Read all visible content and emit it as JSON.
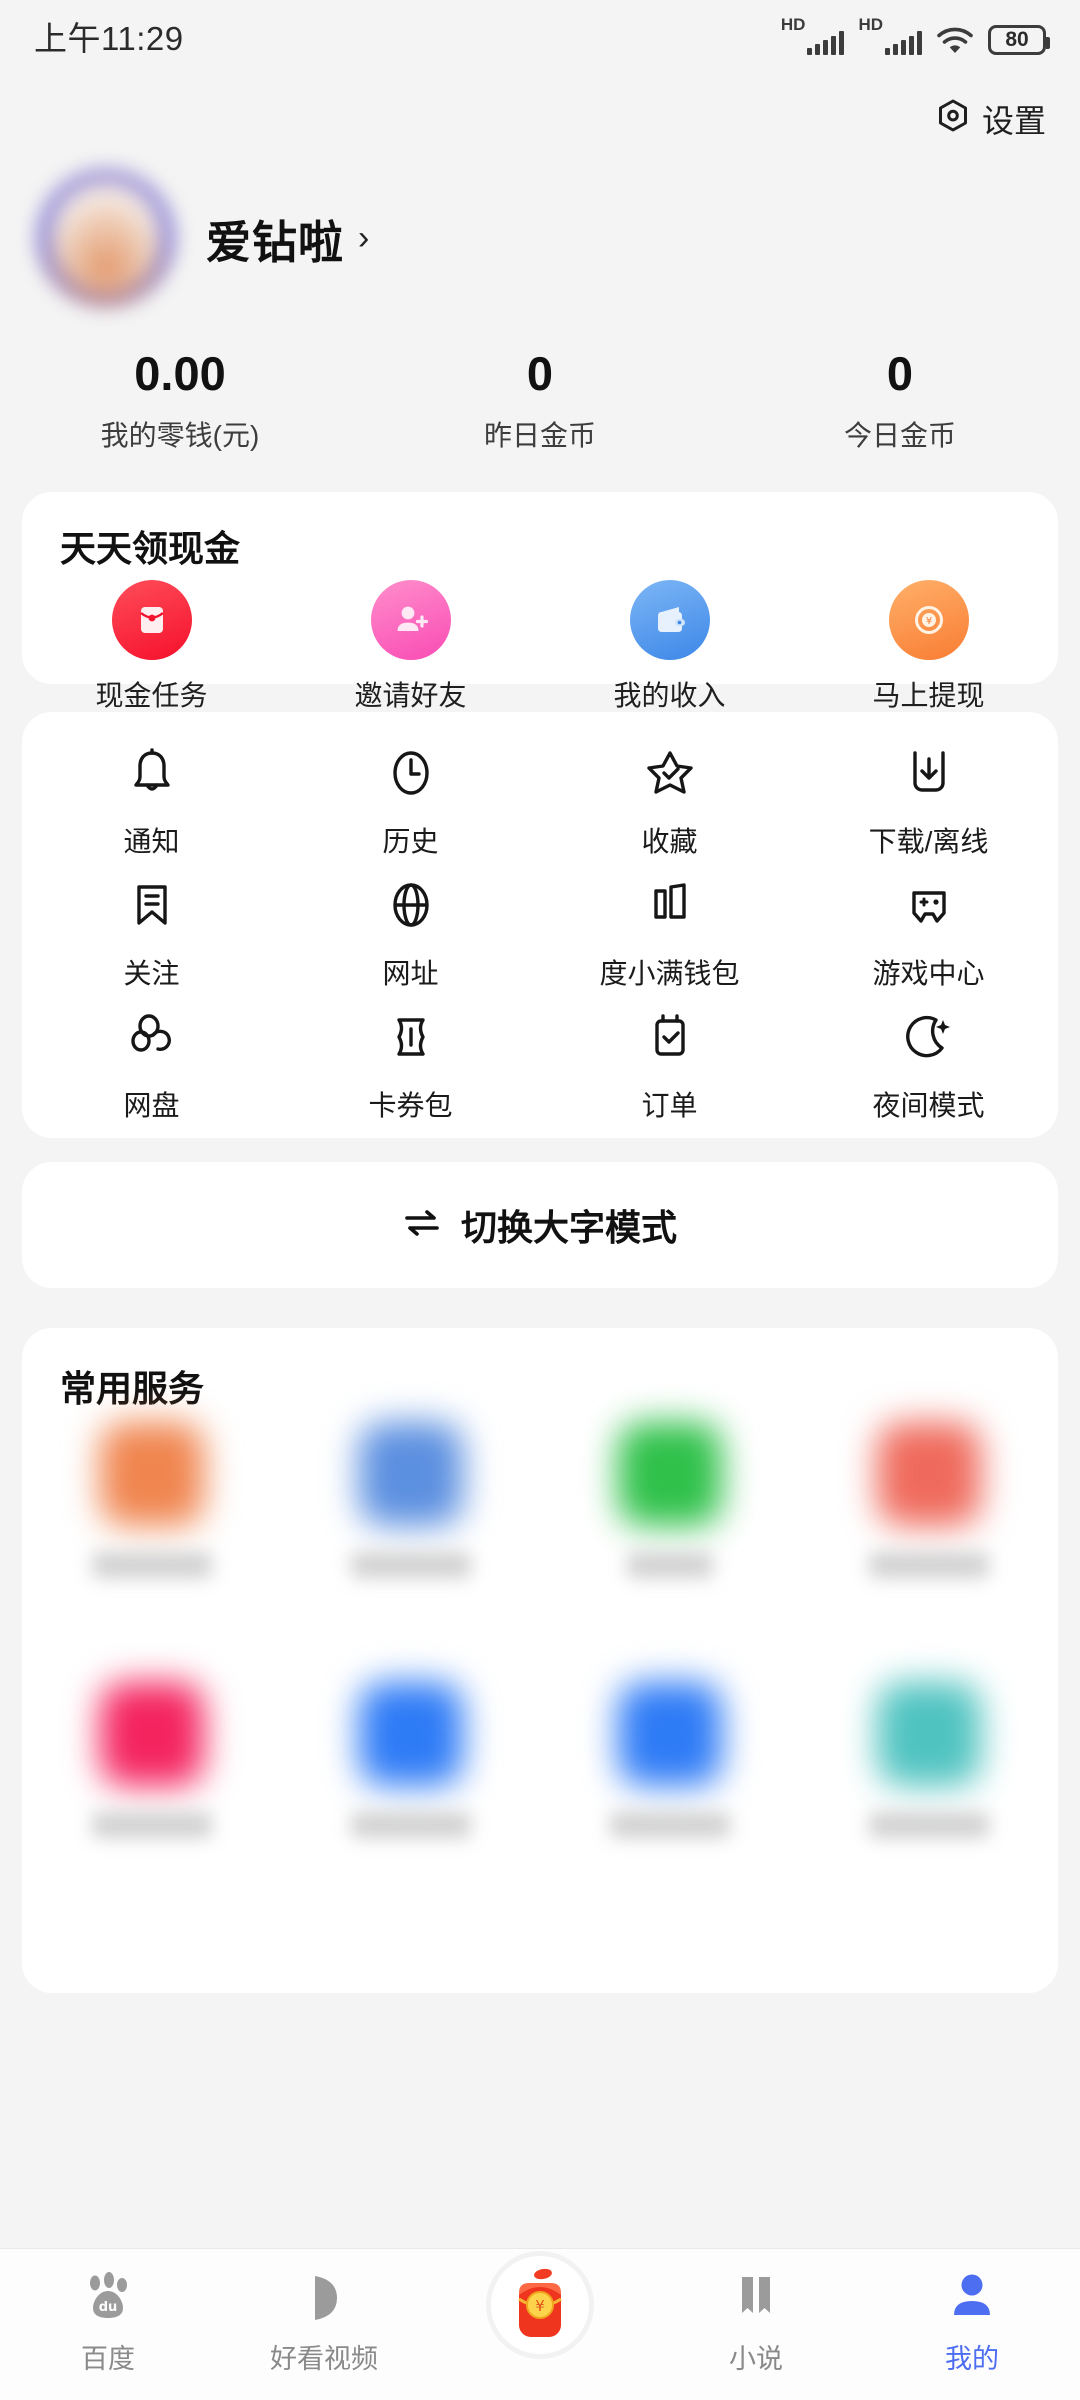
{
  "statusbar": {
    "time": "上午11:29",
    "signal1_label": "HD",
    "signal2_label": "HD",
    "battery_level": "80",
    "wifi_icon": "wifi-icon"
  },
  "header": {
    "settings_label": "设置",
    "settings_icon": "gear-icon"
  },
  "profile": {
    "username": "爱钻啦",
    "chevron": "›",
    "avatar_icon": "avatar"
  },
  "stats": [
    {
      "value": "0.00",
      "caption": "我的零钱(元)"
    },
    {
      "value": "0",
      "caption": "昨日金币"
    },
    {
      "value": "0",
      "caption": "今日金币"
    }
  ],
  "cash_section": {
    "title": "天天领现金",
    "items": [
      {
        "label": "现金任务",
        "icon": "red-envelope-icon",
        "color": "#f5102b"
      },
      {
        "label": "邀请好友",
        "icon": "add-friend-icon",
        "color": "#f94bb4"
      },
      {
        "label": "我的收入",
        "icon": "wallet-icon",
        "color": "#3c87e8"
      },
      {
        "label": "马上提现",
        "icon": "withdraw-coin-icon",
        "color": "#f97c32"
      }
    ]
  },
  "menu_grid": {
    "rows": [
      [
        {
          "label": "通知",
          "icon": "bell-icon"
        },
        {
          "label": "历史",
          "icon": "clock-icon"
        },
        {
          "label": "收藏",
          "icon": "star-check-icon"
        },
        {
          "label": "下载/离线",
          "icon": "download-icon"
        }
      ],
      [
        {
          "label": "关注",
          "icon": "bookmark-icon"
        },
        {
          "label": "网址",
          "icon": "globe-icon"
        },
        {
          "label": "度小满钱包",
          "icon": "duxiaoman-wallet-icon"
        },
        {
          "label": "游戏中心",
          "icon": "gamepad-icon"
        }
      ],
      [
        {
          "label": "网盘",
          "icon": "cloud-disk-icon"
        },
        {
          "label": "卡券包",
          "icon": "ticket-icon"
        },
        {
          "label": "订单",
          "icon": "order-checklist-icon"
        },
        {
          "label": "夜间模式",
          "icon": "moon-icon"
        }
      ]
    ]
  },
  "bigtext_toggle": {
    "label": "切换大字模式",
    "icon": "swap-arrows-icon"
  },
  "services_section": {
    "title": "常用服务",
    "rows": [
      [
        {
          "label": "",
          "icon": "service-icon",
          "color": "#f0854f"
        },
        {
          "label": "",
          "icon": "service-icon",
          "color": "#5b8fe0"
        },
        {
          "label": "",
          "icon": "service-icon",
          "color": "#2fc14a"
        },
        {
          "label": "",
          "icon": "service-icon",
          "color": "#ef6a5c"
        }
      ],
      [
        {
          "label": "",
          "icon": "service-icon",
          "color": "#f4245f"
        },
        {
          "label": "",
          "icon": "service-icon",
          "color": "#2e7bf6"
        },
        {
          "label": "",
          "icon": "service-icon",
          "color": "#2e7bf6"
        },
        {
          "label": "",
          "icon": "service-icon",
          "color": "#4fc3c0"
        }
      ]
    ]
  },
  "navbar": {
    "active_color": "#4e6ef2",
    "items": [
      {
        "label": "百度",
        "icon": "baidu-paw-icon",
        "active": false
      },
      {
        "label": "好看视频",
        "icon": "play-icon",
        "active": false
      },
      {
        "label": "",
        "icon": "red-packet-icon",
        "active": false
      },
      {
        "label": "小说",
        "icon": "book-icon",
        "active": false
      },
      {
        "label": "我的",
        "icon": "person-icon",
        "active": true
      }
    ]
  }
}
